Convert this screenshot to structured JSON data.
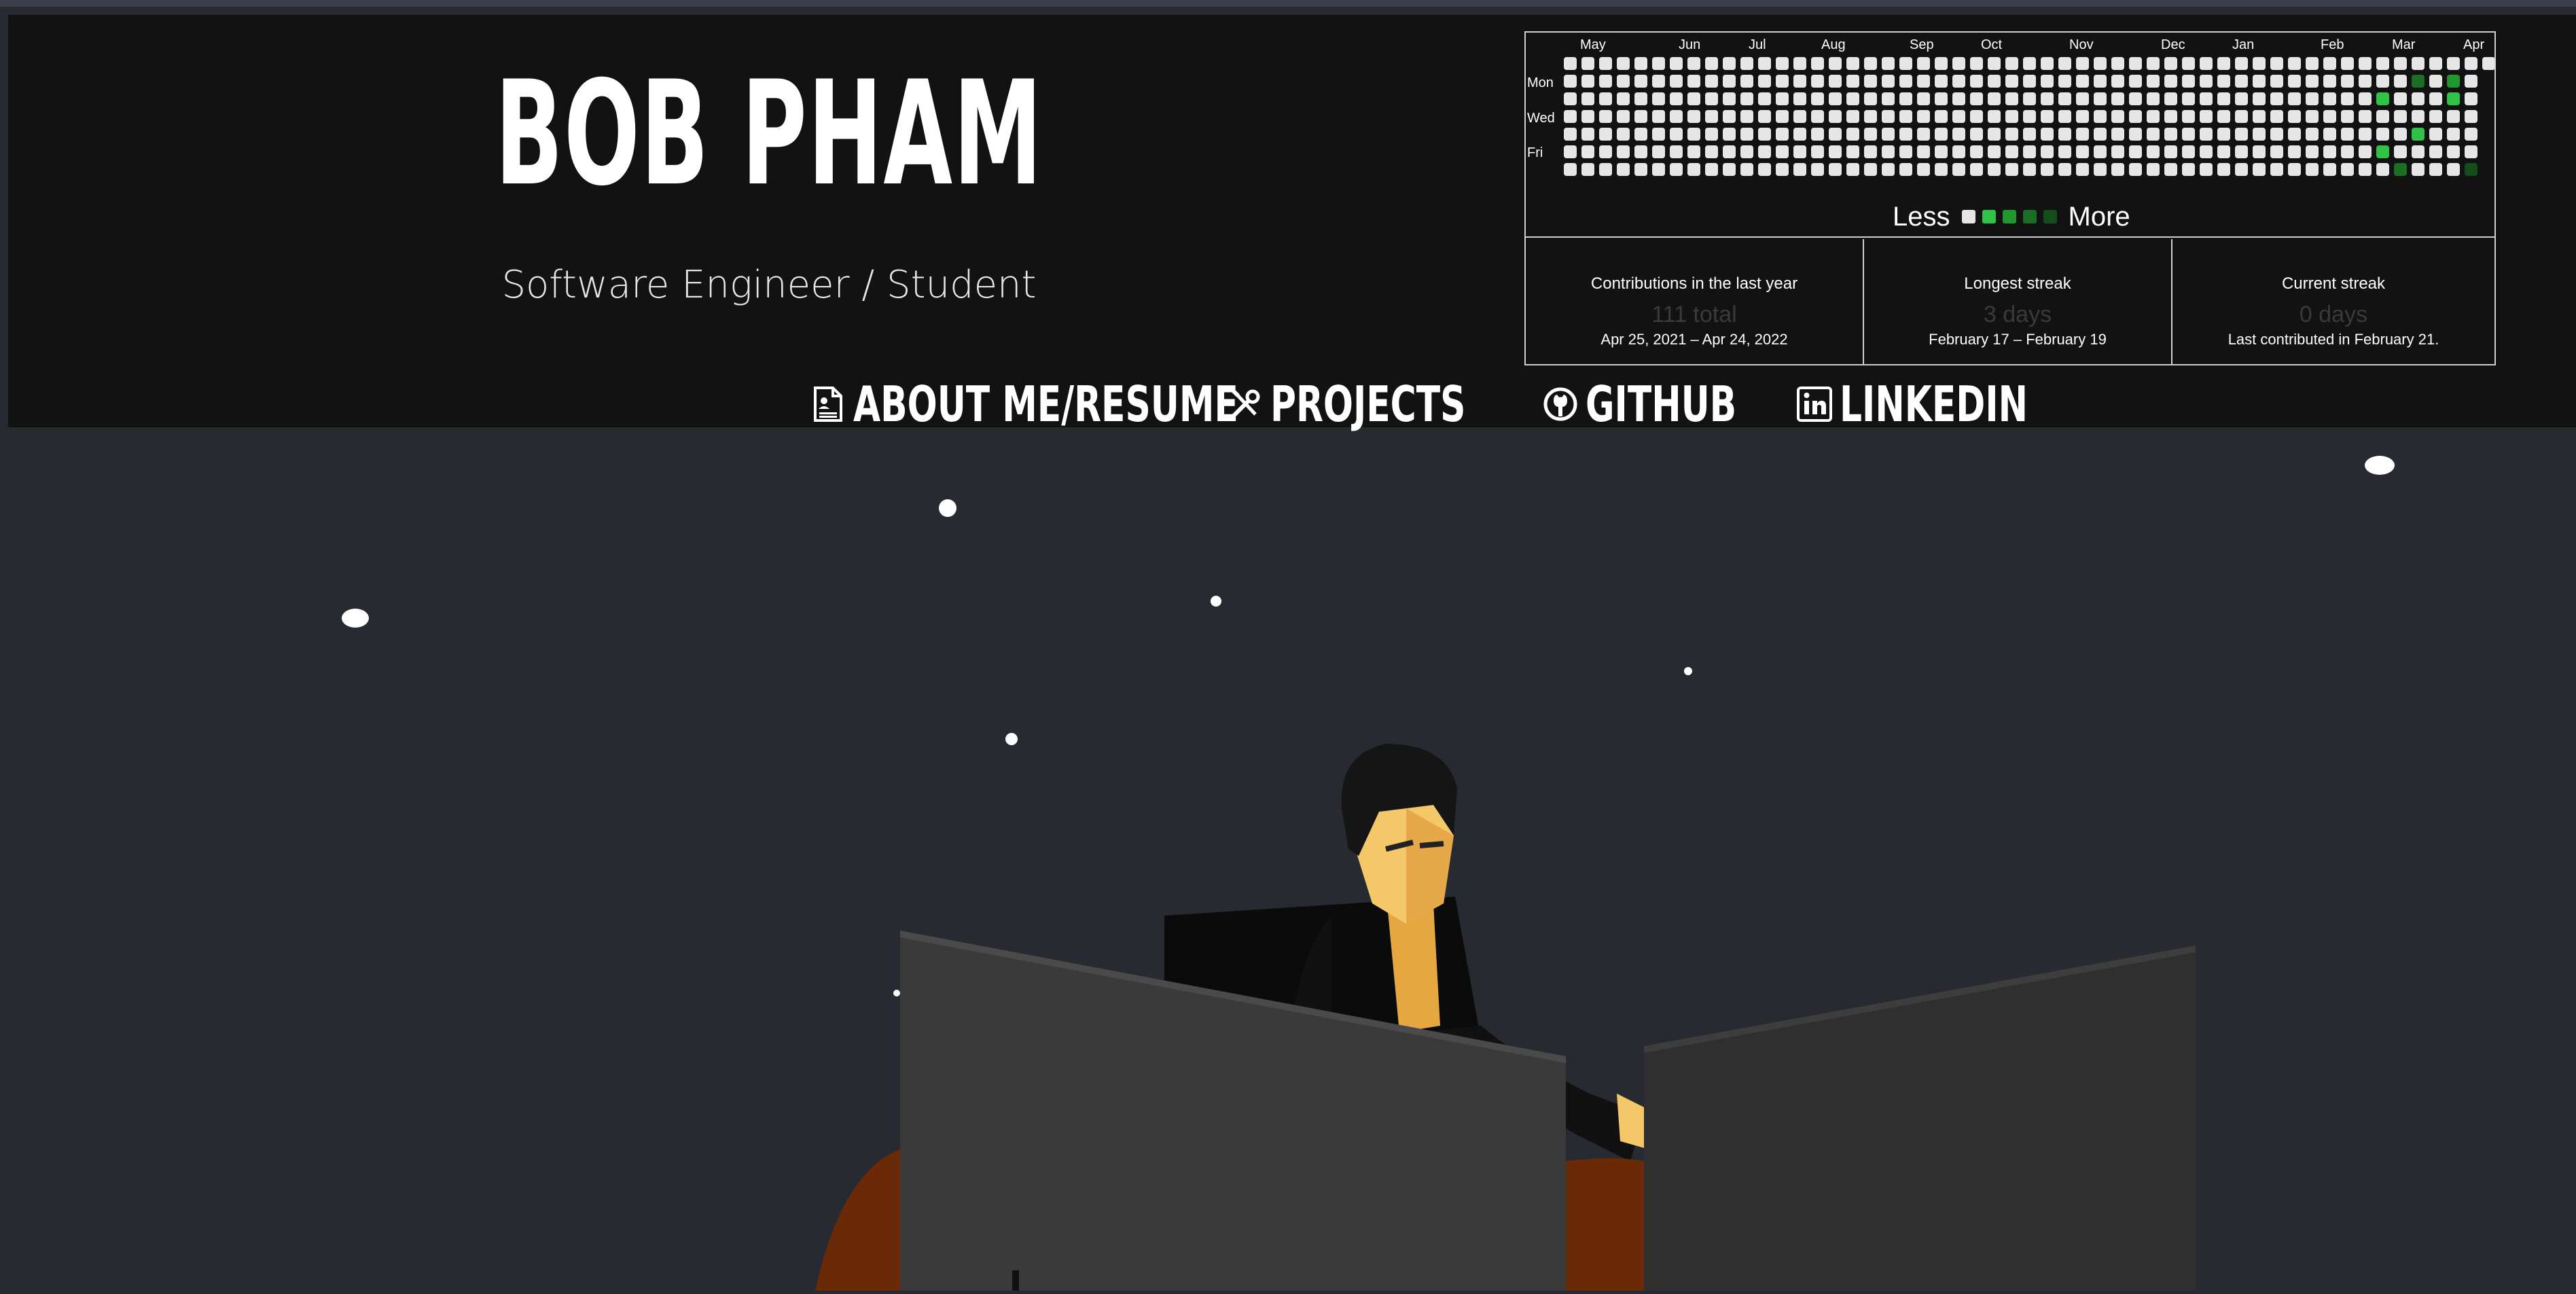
{
  "header": {
    "name": "BOB PHAM",
    "subtitle": "Software Engineer / Student"
  },
  "nav": {
    "items": [
      {
        "label": "ABOUT ME/RESUME",
        "icon": "resume-icon"
      },
      {
        "label": "PROJECTS",
        "icon": "tools-icon"
      },
      {
        "label": "GITHUB",
        "icon": "github-icon"
      },
      {
        "label": "LINKEDIN",
        "icon": "linkedin-icon"
      }
    ]
  },
  "github_calendar": {
    "months": [
      "May",
      "Jun",
      "Jul",
      "Aug",
      "Sep",
      "Oct",
      "Nov",
      "Dec",
      "Jan",
      "Feb",
      "Mar",
      "Apr"
    ],
    "days": [
      "Mon",
      "Wed",
      "Fri"
    ],
    "legend_less": "Less",
    "legend_more": "More",
    "colors": {
      "empty": "#e6e6e6",
      "level1": "#2fc246",
      "level2": "#21962f",
      "level3": "#1b6e25",
      "level4": "#134d1a"
    },
    "stats": [
      {
        "label": "Contributions in the last year",
        "value": "111 total",
        "range": "Apr 25, 2021 – Apr 24, 2022"
      },
      {
        "label": "Longest streak",
        "value": "3 days",
        "range": "February 17 – February 19"
      },
      {
        "label": "Current streak",
        "value": "0 days",
        "range": "Last contributed in February 21."
      }
    ]
  }
}
